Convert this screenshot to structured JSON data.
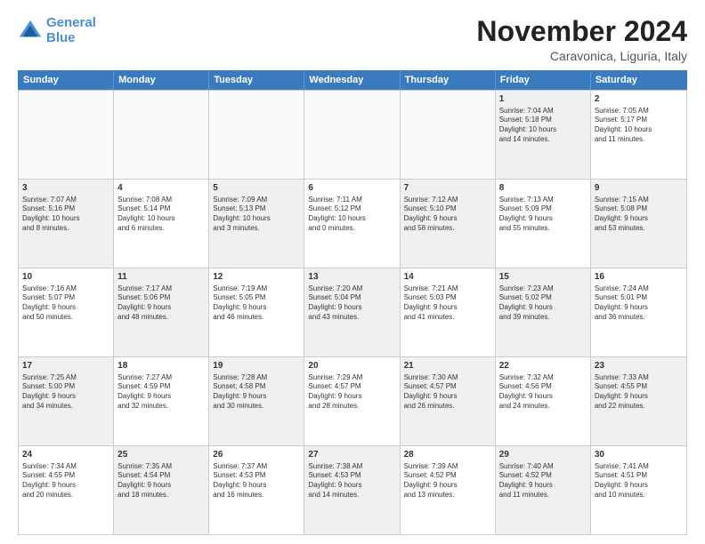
{
  "logo": {
    "line1": "General",
    "line2": "Blue"
  },
  "header": {
    "month": "November 2024",
    "location": "Caravonica, Liguria, Italy"
  },
  "weekdays": [
    "Sunday",
    "Monday",
    "Tuesday",
    "Wednesday",
    "Thursday",
    "Friday",
    "Saturday"
  ],
  "rows": [
    [
      {
        "day": "",
        "info": "",
        "empty": true
      },
      {
        "day": "",
        "info": "",
        "empty": true
      },
      {
        "day": "",
        "info": "",
        "empty": true
      },
      {
        "day": "",
        "info": "",
        "empty": true
      },
      {
        "day": "",
        "info": "",
        "empty": true
      },
      {
        "day": "1",
        "info": "Sunrise: 7:04 AM\nSunset: 5:18 PM\nDaylight: 10 hours\nand 14 minutes.",
        "shaded": true
      },
      {
        "day": "2",
        "info": "Sunrise: 7:05 AM\nSunset: 5:17 PM\nDaylight: 10 hours\nand 11 minutes.",
        "shaded": false
      }
    ],
    [
      {
        "day": "3",
        "info": "Sunrise: 7:07 AM\nSunset: 5:16 PM\nDaylight: 10 hours\nand 8 minutes.",
        "shaded": true
      },
      {
        "day": "4",
        "info": "Sunrise: 7:08 AM\nSunset: 5:14 PM\nDaylight: 10 hours\nand 6 minutes.",
        "shaded": false
      },
      {
        "day": "5",
        "info": "Sunrise: 7:09 AM\nSunset: 5:13 PM\nDaylight: 10 hours\nand 3 minutes.",
        "shaded": true
      },
      {
        "day": "6",
        "info": "Sunrise: 7:11 AM\nSunset: 5:12 PM\nDaylight: 10 hours\nand 0 minutes.",
        "shaded": false
      },
      {
        "day": "7",
        "info": "Sunrise: 7:12 AM\nSunset: 5:10 PM\nDaylight: 9 hours\nand 58 minutes.",
        "shaded": true
      },
      {
        "day": "8",
        "info": "Sunrise: 7:13 AM\nSunset: 5:09 PM\nDaylight: 9 hours\nand 55 minutes.",
        "shaded": false
      },
      {
        "day": "9",
        "info": "Sunrise: 7:15 AM\nSunset: 5:08 PM\nDaylight: 9 hours\nand 53 minutes.",
        "shaded": true
      }
    ],
    [
      {
        "day": "10",
        "info": "Sunrise: 7:16 AM\nSunset: 5:07 PM\nDaylight: 9 hours\nand 50 minutes.",
        "shaded": false
      },
      {
        "day": "11",
        "info": "Sunrise: 7:17 AM\nSunset: 5:06 PM\nDaylight: 9 hours\nand 48 minutes.",
        "shaded": true
      },
      {
        "day": "12",
        "info": "Sunrise: 7:19 AM\nSunset: 5:05 PM\nDaylight: 9 hours\nand 46 minutes.",
        "shaded": false
      },
      {
        "day": "13",
        "info": "Sunrise: 7:20 AM\nSunset: 5:04 PM\nDaylight: 9 hours\nand 43 minutes.",
        "shaded": true
      },
      {
        "day": "14",
        "info": "Sunrise: 7:21 AM\nSunset: 5:03 PM\nDaylight: 9 hours\nand 41 minutes.",
        "shaded": false
      },
      {
        "day": "15",
        "info": "Sunrise: 7:23 AM\nSunset: 5:02 PM\nDaylight: 9 hours\nand 39 minutes.",
        "shaded": true
      },
      {
        "day": "16",
        "info": "Sunrise: 7:24 AM\nSunset: 5:01 PM\nDaylight: 9 hours\nand 36 minutes.",
        "shaded": false
      }
    ],
    [
      {
        "day": "17",
        "info": "Sunrise: 7:25 AM\nSunset: 5:00 PM\nDaylight: 9 hours\nand 34 minutes.",
        "shaded": true
      },
      {
        "day": "18",
        "info": "Sunrise: 7:27 AM\nSunset: 4:59 PM\nDaylight: 9 hours\nand 32 minutes.",
        "shaded": false
      },
      {
        "day": "19",
        "info": "Sunrise: 7:28 AM\nSunset: 4:58 PM\nDaylight: 9 hours\nand 30 minutes.",
        "shaded": true
      },
      {
        "day": "20",
        "info": "Sunrise: 7:29 AM\nSunset: 4:57 PM\nDaylight: 9 hours\nand 28 minutes.",
        "shaded": false
      },
      {
        "day": "21",
        "info": "Sunrise: 7:30 AM\nSunset: 4:57 PM\nDaylight: 9 hours\nand 26 minutes.",
        "shaded": true
      },
      {
        "day": "22",
        "info": "Sunrise: 7:32 AM\nSunset: 4:56 PM\nDaylight: 9 hours\nand 24 minutes.",
        "shaded": false
      },
      {
        "day": "23",
        "info": "Sunrise: 7:33 AM\nSunset: 4:55 PM\nDaylight: 9 hours\nand 22 minutes.",
        "shaded": true
      }
    ],
    [
      {
        "day": "24",
        "info": "Sunrise: 7:34 AM\nSunset: 4:55 PM\nDaylight: 9 hours\nand 20 minutes.",
        "shaded": false
      },
      {
        "day": "25",
        "info": "Sunrise: 7:35 AM\nSunset: 4:54 PM\nDaylight: 9 hours\nand 18 minutes.",
        "shaded": true
      },
      {
        "day": "26",
        "info": "Sunrise: 7:37 AM\nSunset: 4:53 PM\nDaylight: 9 hours\nand 16 minutes.",
        "shaded": false
      },
      {
        "day": "27",
        "info": "Sunrise: 7:38 AM\nSunset: 4:53 PM\nDaylight: 9 hours\nand 14 minutes.",
        "shaded": true
      },
      {
        "day": "28",
        "info": "Sunrise: 7:39 AM\nSunset: 4:52 PM\nDaylight: 9 hours\nand 13 minutes.",
        "shaded": false
      },
      {
        "day": "29",
        "info": "Sunrise: 7:40 AM\nSunset: 4:52 PM\nDaylight: 9 hours\nand 11 minutes.",
        "shaded": true
      },
      {
        "day": "30",
        "info": "Sunrise: 7:41 AM\nSunset: 4:51 PM\nDaylight: 9 hours\nand 10 minutes.",
        "shaded": false
      }
    ]
  ]
}
